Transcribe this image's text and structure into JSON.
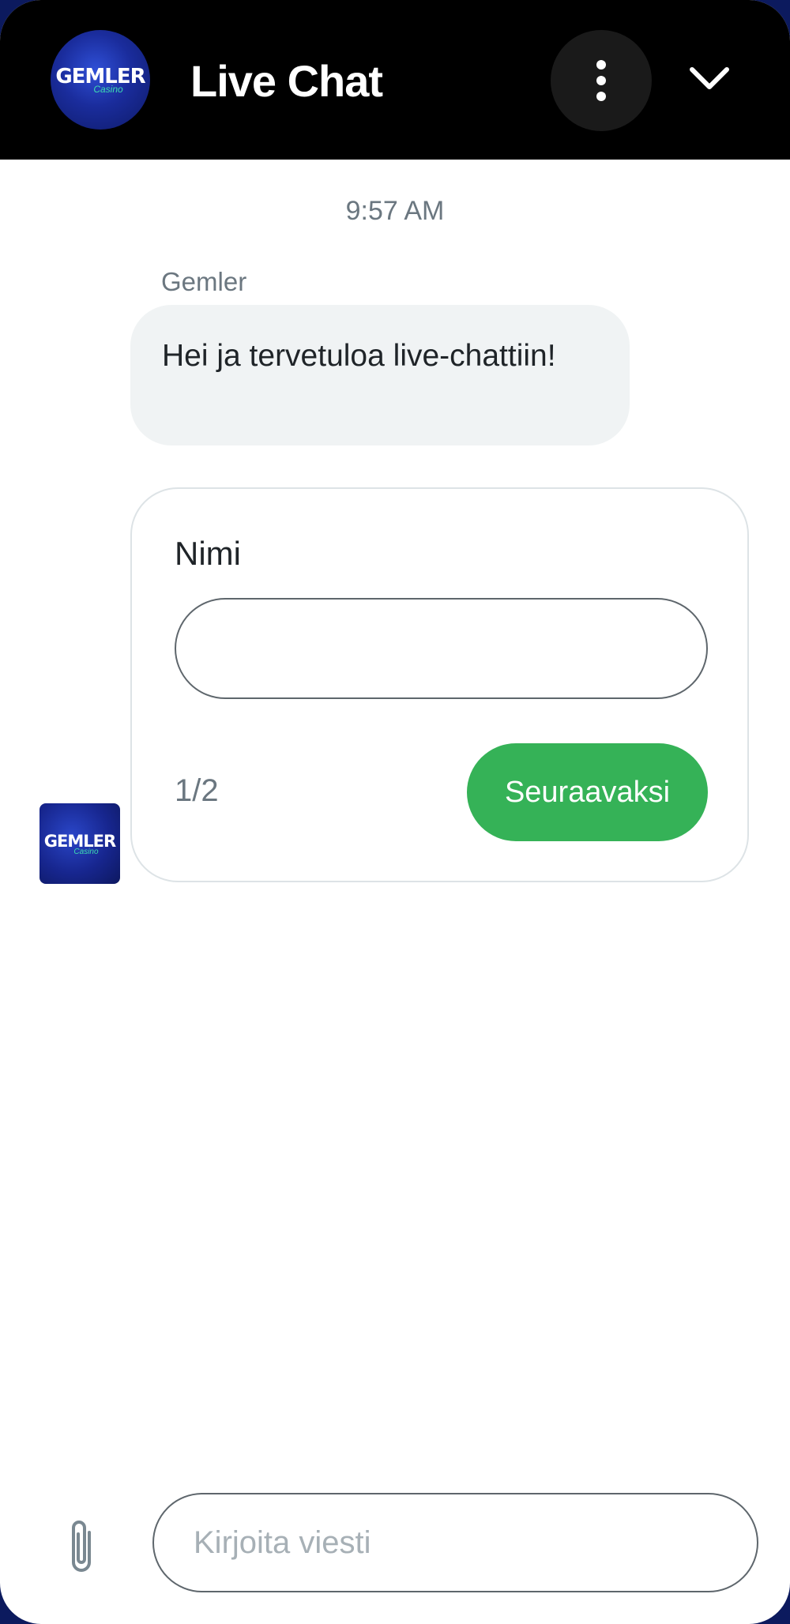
{
  "header": {
    "logo_text": "GEMLER",
    "logo_sub": "Casino",
    "title": "Live Chat",
    "menu_icon": "more-vertical-icon",
    "collapse_icon": "chevron-down-icon"
  },
  "chat": {
    "timestamp": "9:57 AM",
    "sender": "Gemler",
    "message": "Hei ja tervetuloa live-chattiin!",
    "avatar_text": "GEMLER",
    "avatar_sub": "Casino"
  },
  "form": {
    "label": "Nimi",
    "input_value": "",
    "step": "1/2",
    "next_label": "Seuraavaksi"
  },
  "composer": {
    "attach_icon": "paperclip-icon",
    "placeholder": "Kirjoita viesti"
  },
  "colors": {
    "header_bg": "#000000",
    "accent_green": "#35b257",
    "bubble_bg": "#f0f3f4",
    "muted_text": "#6b7780"
  }
}
